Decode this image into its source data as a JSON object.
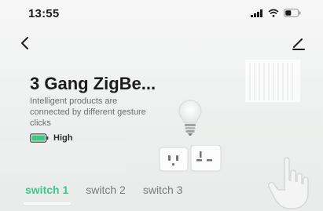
{
  "status_bar": {
    "time": "13:55",
    "icons": [
      "cellular-signal-icon",
      "wifi-icon",
      "battery-icon"
    ]
  },
  "nav": {
    "back_icon": "chevron-left-icon",
    "edit_icon": "pencil-icon"
  },
  "device": {
    "name": "3 Gang ZigBe...",
    "description": "Intelligent products are connected by different gesture clicks",
    "battery_level_label": "High",
    "battery_color": "#3cc88a"
  },
  "illustration": {
    "icons": [
      "light-bulb-icon",
      "wall-socket-icon",
      "hand-pointer-icon"
    ]
  },
  "tabs": [
    {
      "label": "switch 1",
      "active": true
    },
    {
      "label": "switch 2",
      "active": false
    },
    {
      "label": "switch 3",
      "active": false
    }
  ],
  "colors": {
    "accent": "#3cc88a",
    "text_primary": "#1c1c1c",
    "text_secondary": "#6e6e6e"
  }
}
